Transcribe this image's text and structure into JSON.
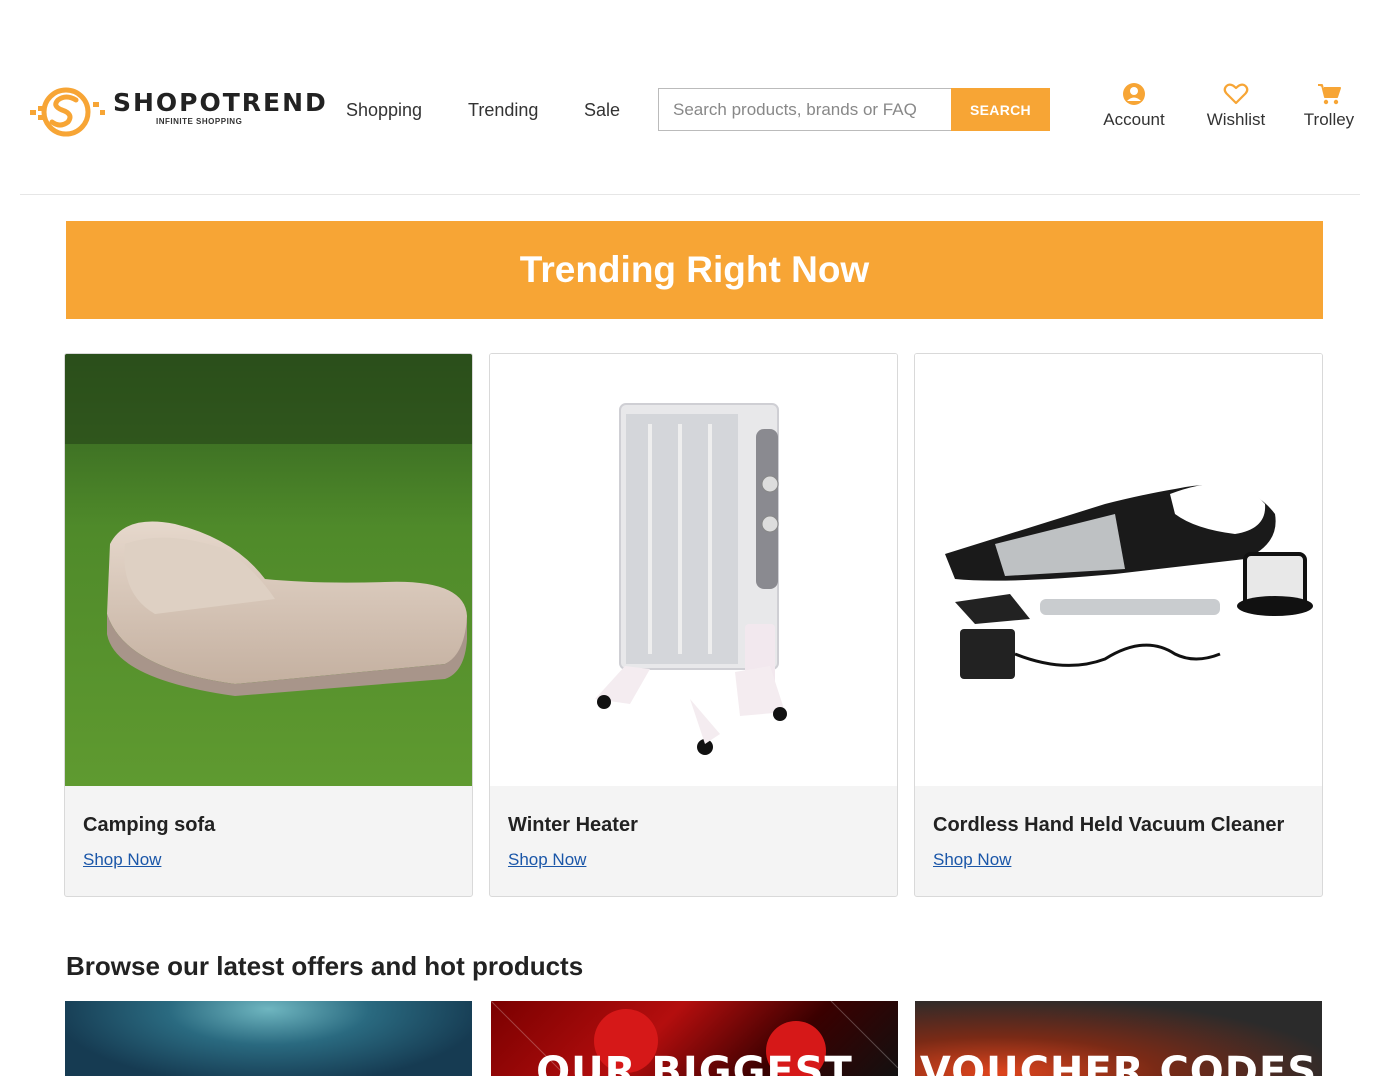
{
  "header": {
    "logo": {
      "name": "SHOPOTREND",
      "tagline": "INFINITE SHOPPING"
    },
    "nav": [
      "Shopping",
      "Trending",
      "Sale"
    ],
    "search": {
      "placeholder": "Search products, brands or FAQ",
      "button_label": "SEARCH"
    },
    "icons": [
      {
        "label": "Account",
        "icon": "account-icon"
      },
      {
        "label": "Wishlist",
        "icon": "heart-icon"
      },
      {
        "label": "Trolley",
        "icon": "cart-icon"
      }
    ]
  },
  "banner": {
    "title": "Trending Right Now"
  },
  "products": [
    {
      "title": "Camping sofa",
      "link": "Shop Now"
    },
    {
      "title": "Winter Heater",
      "link": "Shop Now"
    },
    {
      "title": "Cordless Hand Held Vacuum Cleaner",
      "link": "Shop Now"
    }
  ],
  "offers": {
    "title": "Browse our latest offers and hot products",
    "promos": [
      "",
      "OUR BIGGEST",
      "VOUCHER CODES"
    ]
  },
  "colors": {
    "accent": "#f7a535",
    "link": "#1a56a8",
    "card_bg": "#f4f4f4"
  }
}
